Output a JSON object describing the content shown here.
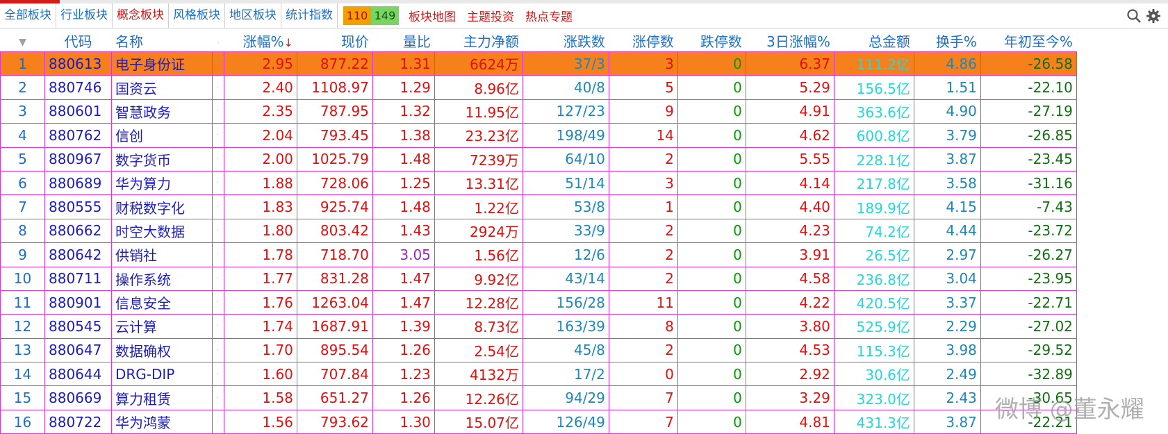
{
  "toolbar": {
    "tabs": [
      "全部板块",
      "行业板块",
      "概念板块",
      "风格板块",
      "地区板块",
      "统计指数"
    ],
    "active_tab": 2,
    "up_count": "110",
    "down_count": "149",
    "links": [
      "板块地图",
      "主题投资",
      "热点专题"
    ]
  },
  "table": {
    "headers": {
      "caret": "▼",
      "code": "代码",
      "name": "名称",
      "mark": "◦",
      "change_pct": "涨幅%",
      "sort_arrow": "↓",
      "price": "现价",
      "volume_ratio": "量比",
      "net_main": "主力净额",
      "up_down": "涨跌数",
      "limit_up": "涨停数",
      "limit_down": "跌停数",
      "change_3d": "3日涨幅%",
      "total_amount": "总金额",
      "turnover": "换手%",
      "ytd": "年初至今%"
    },
    "rows": [
      {
        "idx": "1",
        "code": "880613",
        "name": "电子身份证",
        "change_pct": "2.95",
        "price": "877.22",
        "vol_ratio": "1.31",
        "net": "6624万",
        "updown": "37/3",
        "lu": "3",
        "ld": "0",
        "c3d": "6.37",
        "amount": "111.2亿",
        "turnover": "4.86",
        "ytd": "-26.58"
      },
      {
        "idx": "2",
        "code": "880746",
        "name": "国资云",
        "change_pct": "2.40",
        "price": "1108.97",
        "vol_ratio": "1.29",
        "net": "8.96亿",
        "updown": "40/8",
        "lu": "5",
        "ld": "0",
        "c3d": "5.29",
        "amount": "156.5亿",
        "turnover": "1.51",
        "ytd": "-22.10"
      },
      {
        "idx": "3",
        "code": "880601",
        "name": "智慧政务",
        "change_pct": "2.35",
        "price": "787.95",
        "vol_ratio": "1.32",
        "net": "11.95亿",
        "updown": "127/23",
        "lu": "9",
        "ld": "0",
        "c3d": "4.91",
        "amount": "363.6亿",
        "turnover": "4.90",
        "ytd": "-27.19"
      },
      {
        "idx": "4",
        "code": "880762",
        "name": "信创",
        "change_pct": "2.04",
        "price": "793.45",
        "vol_ratio": "1.38",
        "net": "23.23亿",
        "updown": "198/49",
        "lu": "14",
        "ld": "0",
        "c3d": "4.62",
        "amount": "600.8亿",
        "turnover": "3.79",
        "ytd": "-26.85"
      },
      {
        "idx": "5",
        "code": "880967",
        "name": "数字货币",
        "change_pct": "2.00",
        "price": "1025.79",
        "vol_ratio": "1.48",
        "net": "7239万",
        "updown": "64/10",
        "lu": "2",
        "ld": "0",
        "c3d": "5.55",
        "amount": "228.1亿",
        "turnover": "3.87",
        "ytd": "-23.45"
      },
      {
        "idx": "6",
        "code": "880689",
        "name": "华为算力",
        "change_pct": "1.88",
        "price": "728.06",
        "vol_ratio": "1.25",
        "net": "13.31亿",
        "updown": "51/14",
        "lu": "3",
        "ld": "0",
        "c3d": "4.14",
        "amount": "217.8亿",
        "turnover": "3.58",
        "ytd": "-31.16"
      },
      {
        "idx": "7",
        "code": "880555",
        "name": "财税数字化",
        "change_pct": "1.83",
        "price": "925.74",
        "vol_ratio": "1.48",
        "net": "1.22亿",
        "updown": "53/8",
        "lu": "1",
        "ld": "0",
        "c3d": "4.40",
        "amount": "189.9亿",
        "turnover": "4.15",
        "ytd": "-7.43"
      },
      {
        "idx": "8",
        "code": "880662",
        "name": "时空大数据",
        "change_pct": "1.80",
        "price": "803.42",
        "vol_ratio": "1.43",
        "net": "2924万",
        "updown": "33/9",
        "lu": "2",
        "ld": "0",
        "c3d": "4.23",
        "amount": "74.2亿",
        "turnover": "4.44",
        "ytd": "-23.72"
      },
      {
        "idx": "9",
        "code": "880642",
        "name": "供销社",
        "change_pct": "1.78",
        "price": "718.70",
        "vol_ratio": "3.05",
        "net": "1.56亿",
        "updown": "12/6",
        "lu": "2",
        "ld": "0",
        "c3d": "3.91",
        "amount": "26.5亿",
        "turnover": "2.97",
        "ytd": "-26.27"
      },
      {
        "idx": "10",
        "code": "880711",
        "name": "操作系统",
        "change_pct": "1.77",
        "price": "831.28",
        "vol_ratio": "1.47",
        "net": "9.92亿",
        "updown": "43/14",
        "lu": "2",
        "ld": "0",
        "c3d": "4.58",
        "amount": "236.8亿",
        "turnover": "3.04",
        "ytd": "-23.95"
      },
      {
        "idx": "11",
        "code": "880901",
        "name": "信息安全",
        "change_pct": "1.76",
        "price": "1263.04",
        "vol_ratio": "1.47",
        "net": "12.28亿",
        "updown": "156/28",
        "lu": "11",
        "ld": "0",
        "c3d": "4.22",
        "amount": "420.5亿",
        "turnover": "3.37",
        "ytd": "-22.71"
      },
      {
        "idx": "12",
        "code": "880545",
        "name": "云计算",
        "change_pct": "1.74",
        "price": "1687.91",
        "vol_ratio": "1.39",
        "net": "8.73亿",
        "updown": "163/39",
        "lu": "8",
        "ld": "0",
        "c3d": "3.80",
        "amount": "525.9亿",
        "turnover": "2.29",
        "ytd": "-27.02"
      },
      {
        "idx": "13",
        "code": "880647",
        "name": "数据确权",
        "change_pct": "1.70",
        "price": "895.54",
        "vol_ratio": "1.26",
        "net": "2.54亿",
        "updown": "45/8",
        "lu": "2",
        "ld": "0",
        "c3d": "4.53",
        "amount": "115.3亿",
        "turnover": "3.98",
        "ytd": "-29.52"
      },
      {
        "idx": "14",
        "code": "880644",
        "name": "DRG-DIP",
        "change_pct": "1.60",
        "price": "707.84",
        "vol_ratio": "1.23",
        "net": "4132万",
        "updown": "17/2",
        "lu": "0",
        "ld": "0",
        "c3d": "2.92",
        "amount": "30.6亿",
        "turnover": "2.49",
        "ytd": "-32.89"
      },
      {
        "idx": "15",
        "code": "880669",
        "name": "算力租赁",
        "change_pct": "1.58",
        "price": "651.27",
        "vol_ratio": "1.26",
        "net": "12.26亿",
        "updown": "94/29",
        "lu": "7",
        "ld": "0",
        "c3d": "3.29",
        "amount": "323.0亿",
        "turnover": "2.43",
        "ytd": "-30.65"
      },
      {
        "idx": "16",
        "code": "880722",
        "name": "华为鸿蒙",
        "change_pct": "1.56",
        "price": "793.62",
        "vol_ratio": "1.30",
        "net": "15.07亿",
        "updown": "126/49",
        "lu": "7",
        "ld": "0",
        "c3d": "4.81",
        "amount": "431.3亿",
        "turnover": "3.87",
        "ytd": "-22.21"
      }
    ],
    "selected_row": 0
  },
  "watermark": "微博 @董永耀",
  "icons": [
    "search-icon",
    "gear-icon"
  ],
  "colors": {
    "accent_red": "#e01010",
    "header_blue": "#1d6fc4",
    "grid_magenta": "#e033e0",
    "selected_row": "#f6801c",
    "amount_cyan": "#24d8d8"
  }
}
